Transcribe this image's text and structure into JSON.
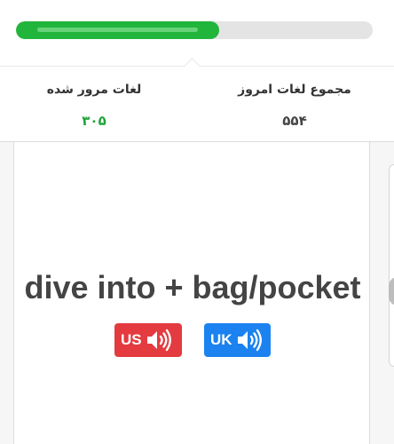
{
  "progress": {
    "percent": 57,
    "fill_color": "#22b53c",
    "track_color": "#e4e4e4"
  },
  "stats": {
    "today_total": {
      "label": "مجموع لغات امروز",
      "value": "۵۵۴"
    },
    "reviewed": {
      "label": "لغات مرور شده",
      "value": "۳۰۵",
      "color": "#22a33b"
    }
  },
  "flashcard": {
    "word": "dive into + bag/pocket",
    "pronunciations": [
      {
        "label": "US",
        "icon": "speaker-icon",
        "color": "#e33b3f"
      },
      {
        "label": "UK",
        "icon": "speaker-icon",
        "color": "#1b82f0"
      }
    ]
  }
}
